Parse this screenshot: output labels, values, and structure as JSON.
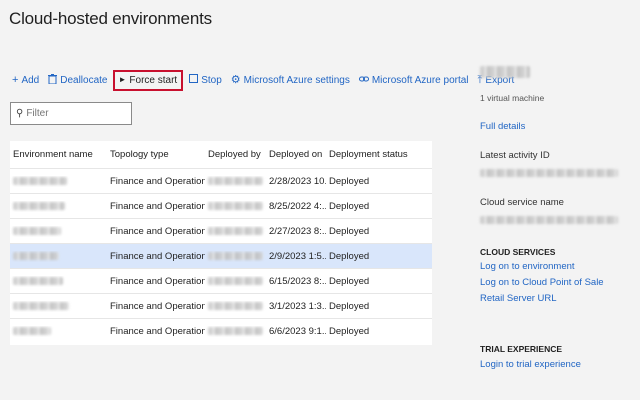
{
  "page": {
    "title": "Cloud-hosted environments"
  },
  "toolbar": {
    "add": "Add",
    "deallocate": "Deallocate",
    "force_start": "Force start",
    "stop": "Stop",
    "azure_settings": "Microsoft Azure settings",
    "azure_portal": "Microsoft Azure portal",
    "export": "Export",
    "highlight_color": "#c8102e",
    "link_color": "#2266c4"
  },
  "filter": {
    "placeholder": "Filter"
  },
  "grid": {
    "columns": [
      "Environment name",
      "Topology type",
      "Deployed by",
      "Deployed on",
      "Deployment status"
    ],
    "rows": [
      {
        "topology": "Finance and Operations...",
        "deployed_on": "2/28/2023 10...",
        "status": "Deployed"
      },
      {
        "topology": "Finance and Operations...",
        "deployed_on": "8/25/2022 4:...",
        "status": "Deployed"
      },
      {
        "topology": "Finance and Operations...",
        "deployed_on": "2/27/2023 8:...",
        "status": "Deployed"
      },
      {
        "topology": "Finance and Operations...",
        "deployed_on": "2/9/2023 1:5...",
        "status": "Deployed"
      },
      {
        "topology": "Finance and Operations...",
        "deployed_on": "6/15/2023 8:...",
        "status": "Deployed"
      },
      {
        "topology": "Finance and Operations...",
        "deployed_on": "3/1/2023 1:3...",
        "status": "Deployed"
      },
      {
        "topology": "Finance and Operations...",
        "deployed_on": "6/6/2023 9:1...",
        "status": "Deployed"
      }
    ],
    "selected_row_color": "#d9e6fb"
  },
  "side": {
    "vm_count": "1 virtual machine",
    "full_details": "Full details",
    "latest_activity_label": "Latest activity ID",
    "cloud_service_label": "Cloud service name",
    "cloud_services_heading": "CLOUD SERVICES",
    "log_on_env": "Log on to environment",
    "log_on_pos": "Log on to Cloud Point of Sale",
    "retail_url": "Retail Server URL",
    "trial_heading": "TRIAL EXPERIENCE",
    "trial_login": "Login to trial experience"
  }
}
